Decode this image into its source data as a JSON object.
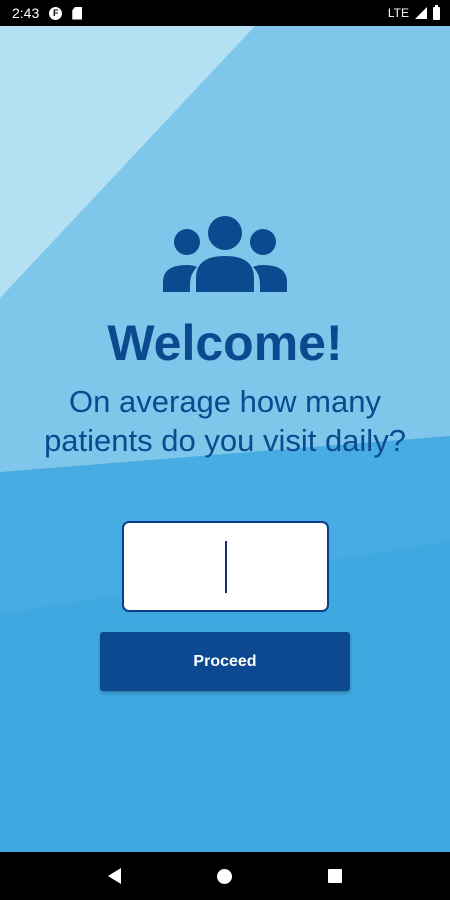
{
  "status_bar": {
    "time": "2:43",
    "network": "LTE"
  },
  "main": {
    "title": "Welcome!",
    "question": "On average how many patients do you visit daily?",
    "input_value": "",
    "proceed_label": "Proceed"
  },
  "colors": {
    "primary_blue": "#0b4a8f",
    "button_blue": "#0d4990",
    "background_blue": "#3fa8e0",
    "light_blue": "#7ec7ea"
  },
  "icons": {
    "header": "people-group-icon"
  }
}
